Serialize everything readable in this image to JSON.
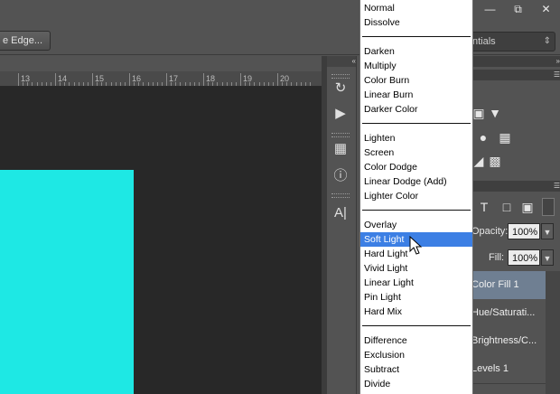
{
  "options_bar": {
    "refine_button_label": "e Edge...",
    "workspace_value": "ntials"
  },
  "ruler": {
    "ticks": [
      "13",
      "14",
      "15",
      "16",
      "17",
      "18",
      "19",
      "20"
    ]
  },
  "adjust_panel": {
    "icons": [
      "triangle-down-icon",
      "circles-icon",
      "grid-icon",
      "gradient-map-icon"
    ]
  },
  "layers_panel": {
    "opacity_label": "Opacity:",
    "opacity_value": "100%",
    "fill_label": "Fill:",
    "fill_value": "100%",
    "layers": [
      {
        "name": "Color Fill 1",
        "selected": true
      },
      {
        "name": "Hue/Saturati...",
        "selected": false
      },
      {
        "name": "Brightness/C...",
        "selected": false
      },
      {
        "name": "Levels 1",
        "selected": false
      }
    ]
  },
  "blend_menu": {
    "groups": [
      [
        "Normal",
        "Dissolve"
      ],
      [
        "Darken",
        "Multiply",
        "Color Burn",
        "Linear Burn",
        "Darker Color"
      ],
      [
        "Lighten",
        "Screen",
        "Color Dodge",
        "Linear Dodge (Add)",
        "Lighter Color"
      ],
      [
        "Overlay",
        "Soft Light",
        "Hard Light",
        "Vivid Light",
        "Linear Light",
        "Pin Light",
        "Hard Mix"
      ],
      [
        "Difference",
        "Exclusion",
        "Subtract",
        "Divide"
      ]
    ],
    "highlighted": "Soft Light"
  },
  "colors": {
    "canvas_fill": "#1ee8e4",
    "highlight": "#3c7fe4",
    "selected_layer": "#6f7f92"
  }
}
